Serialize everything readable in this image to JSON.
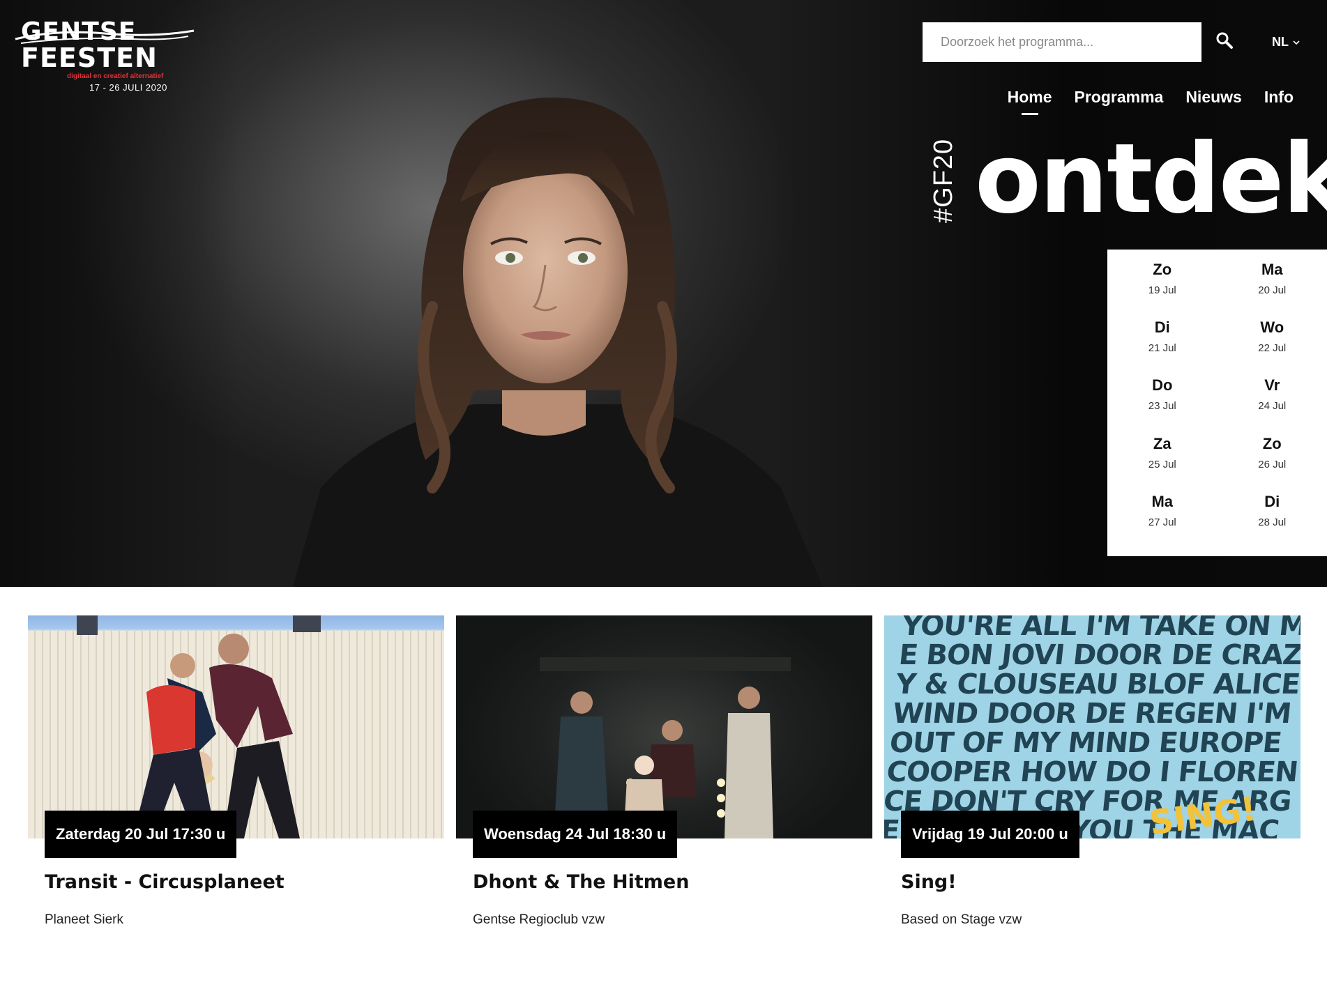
{
  "header": {
    "logo": {
      "line1": "GENTSE",
      "line2": "FEESTEN",
      "subtitle": "digitaal en creatief alternatief",
      "dates": "17 - 26 JULI 2020"
    },
    "search": {
      "placeholder": "Doorzoek het programma..."
    },
    "language": "NL",
    "nav": [
      {
        "label": "Home",
        "active": true
      },
      {
        "label": "Programma",
        "active": false
      },
      {
        "label": "Nieuws",
        "active": false
      },
      {
        "label": "Info",
        "active": false
      }
    ]
  },
  "hero": {
    "hashtag": "#GF20",
    "headline": "ontdek"
  },
  "calendar": {
    "days": [
      {
        "name": "Zo",
        "date": "19 Jul"
      },
      {
        "name": "Ma",
        "date": "20 Jul"
      },
      {
        "name": "Di",
        "date": "21 Jul"
      },
      {
        "name": "Wo",
        "date": "22 Jul"
      },
      {
        "name": "Do",
        "date": "23 Jul"
      },
      {
        "name": "Vr",
        "date": "24 Jul"
      },
      {
        "name": "Za",
        "date": "25 Jul"
      },
      {
        "name": "Zo",
        "date": "26 Jul"
      },
      {
        "name": "Ma",
        "date": "27 Jul"
      },
      {
        "name": "Di",
        "date": "28 Jul"
      }
    ]
  },
  "events": [
    {
      "datetime": "Zaterdag 20 Jul 17:30 u",
      "title": "Transit - Circusplaneet",
      "organizer": "Planeet Sierk"
    },
    {
      "datetime": "Woensdag 24 Jul 18:30 u",
      "title": "Dhont & The Hitmen",
      "organizer": "Gentse Regioclub vzw"
    },
    {
      "datetime": "Vrijdag 19 Jul 20:00 u",
      "title": "Sing!",
      "organizer": "Based on Stage vzw"
    }
  ],
  "poster": {
    "text": "YOU'RE ALL I'M TAKE ON ME BON JOVI DOOR DE CRAZY & CLOUSEAU BLOF ALICE WIND DOOR DE REGEN I'M OUT OF MY MIND EUROPE COOPER HOW DO I FLORENCE DON'T CRY FOR ME ARGENTINA GET YOU THE MACHINE BACKSTREET BOYS ALONE",
    "highlight": "SING!"
  },
  "colors": {
    "accent_red": "#e0313a",
    "black": "#000000",
    "white": "#ffffff"
  }
}
